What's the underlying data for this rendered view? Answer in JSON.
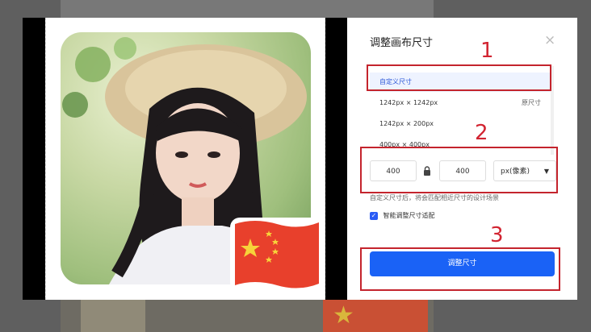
{
  "dialog": {
    "title": "调整画布尺寸",
    "close_icon": "×"
  },
  "size_options": [
    {
      "label": "自定义尺寸",
      "sub": "",
      "selected": true
    },
    {
      "label": "1242px × 1242px",
      "sub": "原尺寸",
      "selected": false
    },
    {
      "label": "1242px × 200px",
      "sub": "",
      "selected": false
    },
    {
      "label": "400px × 400px",
      "sub": "",
      "selected": false
    }
  ],
  "dimensions": {
    "width": "400",
    "height": "400",
    "unit": "px(像素)",
    "lock_icon": "lock-icon",
    "caret_icon": "▼"
  },
  "hint": "自定义尺寸后，将会匹配相近尺寸的设计场景",
  "smart_fit": {
    "checked": true,
    "check_icon": "✓",
    "label": "智能调整尺寸适配"
  },
  "confirm_button": "调整尺寸",
  "annotations": [
    {
      "number": "1"
    },
    {
      "number": "2"
    },
    {
      "number": "3"
    }
  ],
  "colors": {
    "accent": "#1a62f6",
    "annotation": "#c4242d"
  }
}
